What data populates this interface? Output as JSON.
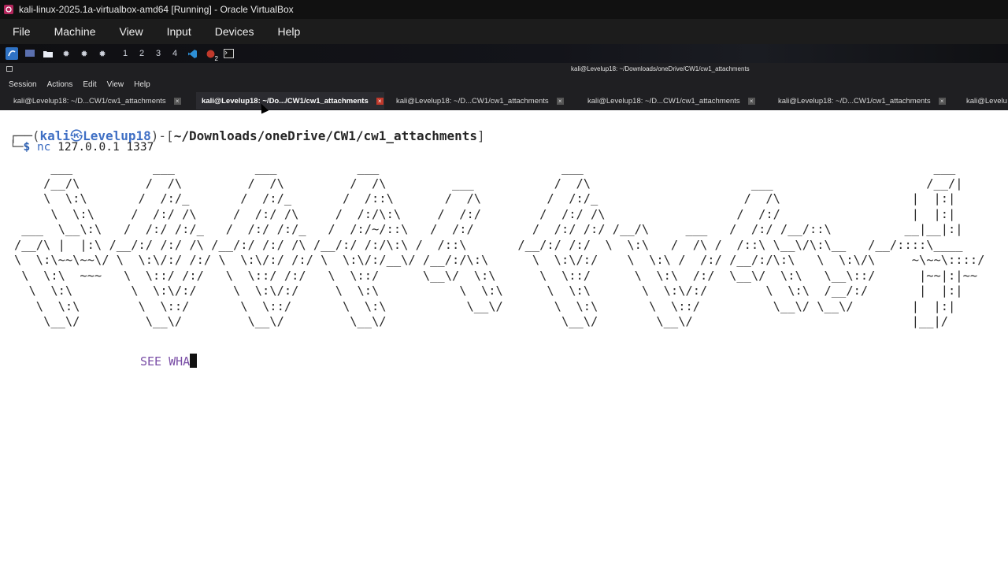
{
  "vbox": {
    "title": "kali-linux-2025.1a-virtualbox-amd64 [Running] - Oracle VirtualBox",
    "menu": [
      "File",
      "Machine",
      "View",
      "Input",
      "Devices",
      "Help"
    ]
  },
  "panel": {
    "workspaces": [
      "1",
      "2",
      "3",
      "4"
    ],
    "notification_count": "2"
  },
  "terminal": {
    "window_title": "kali@Levelup18: ~/Downloads/oneDrive/CW1/cw1_attachments",
    "menu": [
      "Session",
      "Actions",
      "Edit",
      "View",
      "Help"
    ],
    "tabs": [
      {
        "label": "kali@Levelup18: ~/D...CW1/cw1_attachments"
      },
      {
        "label": "kali@Levelup18: ~/Do.../CW1/cw1_attachments"
      },
      {
        "label": "kali@Levelup18: ~/D...CW1/cw1_attachments"
      },
      {
        "label": "kali@Levelup18: ~/D...CW1/cw1_attachments"
      },
      {
        "label": "kali@Levelup18: ~/D...CW1/cw1_attachments"
      },
      {
        "label": "kali@Levelu"
      }
    ],
    "active_tab": 1,
    "prompt": {
      "user": "kali",
      "host": "Levelup18",
      "path": "~/Downloads/oneDrive/CW1/cw1_attachments",
      "dollar": "$",
      "command": "nc",
      "args": "127.0.0.1 1337"
    },
    "ascii_art": "     ___           ___           ___           ___                         ___                                                ___\n    /__/\\         /  /\\         /  /\\         /  /\\         ___           /  /\\                      ___                     /__/|\n    \\  \\:\\       /  /:/_       /  /:/_       /  /::\\       /  /\\         /  /:/_                    /  /\\                  |  |:|\n     \\  \\:\\     /  /:/ /\\     /  /:/ /\\     /  /:/\\:\\     /  /:/        /  /:/ /\\                  /  /:/                  |  |:|\n ___  \\__\\:\\   /  /:/ /:/_   /  /:/ /:/_   /  /:/~/::\\   /  /:/        /  /:/ /:/ /__/\\     ___   /  /:/ /__/::\\          __|__|:|\n/__/\\ |  |:\\ /__/:/ /:/ /\\ /__/:/ /:/ /\\ /__/:/ /:/\\:\\ /  /::\\       /__/:/ /:/  \\  \\:\\   /  /\\ /  /::\\ \\__\\/\\:\\__   /__/::::\\____\n\\  \\:\\~~\\~~\\/ \\  \\:\\/:/ /:/ \\  \\:\\/:/ /:/ \\  \\:\\/:/__\\/ /__/:/\\:\\      \\  \\:\\/:/    \\  \\:\\ /  /:/ /__/:/\\:\\   \\  \\:\\/\\     ~\\~~\\::::/\n \\  \\:\\  ~~~   \\  \\::/ /:/   \\  \\::/ /:/   \\  \\::/      \\__\\/  \\:\\      \\  \\::/      \\  \\:\\  /:/  \\__\\/  \\:\\   \\__\\::/      |~~|:|~~\n  \\  \\:\\        \\  \\:\\/:/     \\  \\:\\/:/     \\  \\:\\           \\  \\:\\      \\  \\:\\       \\  \\:\\/:/        \\  \\:\\  /__/:/       |  |:|\n   \\  \\:\\        \\  \\::/       \\  \\::/       \\  \\:\\           \\__\\/       \\  \\:\\       \\  \\::/          \\__\\/ \\__\\/        |  |:|\n    \\__\\/         \\__\\/         \\__\\/         \\__\\/                        \\__\\/        \\__\\/                              |__|/",
    "output_text": "SEE WHA"
  },
  "colors": {
    "user_blue": "#3f6fc4",
    "output_purple": "#7a4ea6",
    "active_tab_close": "#c0392b"
  }
}
